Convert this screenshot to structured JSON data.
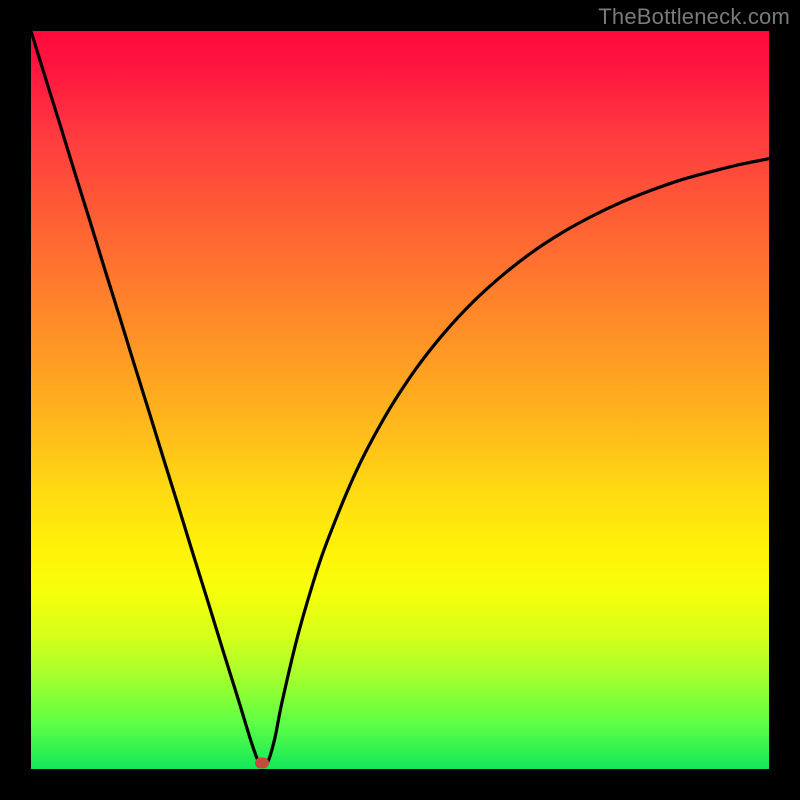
{
  "watermark": "TheBottleneck.com",
  "colors": {
    "frame": "#000000",
    "curve": "#000000",
    "marker": "#c54a3a",
    "gradient_top": "#ff0a3a",
    "gradient_bottom": "#14e75a"
  },
  "chart_data": {
    "type": "line",
    "title": "",
    "xlabel": "",
    "ylabel": "",
    "xlim": [
      0,
      100
    ],
    "ylim": [
      0,
      100
    ],
    "x": [
      0,
      2,
      4,
      6,
      8,
      10,
      12,
      14,
      16,
      18,
      20,
      22,
      24,
      26,
      28,
      30,
      31,
      32,
      33,
      34,
      36,
      38,
      40,
      44,
      48,
      52,
      56,
      60,
      64,
      68,
      72,
      76,
      80,
      84,
      88,
      92,
      96,
      100
    ],
    "y": [
      100,
      93.5,
      87.1,
      80.6,
      74.2,
      67.7,
      61.3,
      54.8,
      48.4,
      41.9,
      35.5,
      29.0,
      22.6,
      16.1,
      9.7,
      3.2,
      0.8,
      0.8,
      4.0,
      9.0,
      17.5,
      24.5,
      30.5,
      40.2,
      47.8,
      54.0,
      59.1,
      63.4,
      67.0,
      70.1,
      72.7,
      74.9,
      76.8,
      78.4,
      79.8,
      80.9,
      81.9,
      82.7
    ],
    "marker": {
      "x": 31.3,
      "y": 0.8
    },
    "grid": false,
    "legend": false
  }
}
